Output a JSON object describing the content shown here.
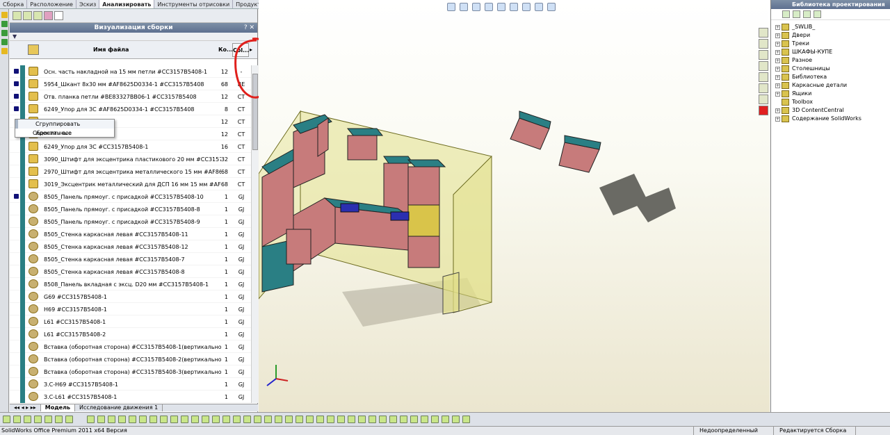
{
  "menu_tabs": [
    "Сборка",
    "Расположение",
    "Эскиз",
    "Анализировать",
    "Инструменты отрисовки",
    "Продукты Office",
    "Макрос"
  ],
  "active_tab": "Анализировать",
  "panel": {
    "title": "Визуализация сборки",
    "title_controls": "? ✕",
    "filter_icon": "filter-icon",
    "columns": {
      "name": "Имя файла",
      "qty": "Ко...",
      "col": "Col..."
    },
    "rows": [
      {
        "name": "Осн. часть накладной на 15 мм петли #CC3157B5408-1",
        "qty": "12",
        "col": "-"
      },
      {
        "name": "5954_Шкант 8х30 мм #AF8625D0334-1 #CC3157B5408",
        "qty": "68",
        "col": "BE"
      },
      {
        "name": "Отв. планка петли #BE83327BB06-1 #CC3157B5408",
        "qty": "12",
        "col": "CT"
      },
      {
        "name": "6249_Упор для ЗС #AF8625D0334-1 #CC3157B5408",
        "qty": "8",
        "col": "CT"
      },
      {
        "name": "5408-1",
        "qty": "12",
        "col": "CT"
      },
      {
        "name": "1",
        "qty": "12",
        "col": "CT"
      },
      {
        "name": "6249_Упор для ЗС #CC3157B5408-1",
        "qty": "16",
        "col": "CT"
      },
      {
        "name": "3090_Штифт для эксцентрика пластикового 20 мм #CC3157B5408-1",
        "qty": "32",
        "col": "CT"
      },
      {
        "name": "2970_Штифт для эксцентрика металлического 15 мм #AF8625D0334-1 #CC...",
        "qty": "68",
        "col": "CT"
      },
      {
        "name": "3019_Эксцентрик металлический для ДСП 16 мм 15 мм #AF8625D033...",
        "qty": "68",
        "col": "CT"
      },
      {
        "name": "8505_Панель прямоуг. с присадкой #CC3157B5408-10",
        "qty": "1",
        "col": "GJ"
      },
      {
        "name": "8505_Панель прямоуг. с присадкой #CC3157B5408-8",
        "qty": "1",
        "col": "GJ"
      },
      {
        "name": "8505_Панель прямоуг. с присадкой #CC3157B5408-9",
        "qty": "1",
        "col": "GJ"
      },
      {
        "name": "8505_Стенка каркасная левая #CC3157B5408-11",
        "qty": "1",
        "col": "GJ"
      },
      {
        "name": "8505_Стенка каркасная левая #CC3157B5408-12",
        "qty": "1",
        "col": "GJ"
      },
      {
        "name": "8505_Стенка каркасная левая #CC3157B5408-7",
        "qty": "1",
        "col": "GJ"
      },
      {
        "name": "8505_Стенка каркасная левая #CC3157B5408-8",
        "qty": "1",
        "col": "GJ"
      },
      {
        "name": "8508_Панель вкладная с эксц. D20 мм #CC3157B5408-1",
        "qty": "1",
        "col": "GJ"
      },
      {
        "name": "G69 #CC3157B5408-1",
        "qty": "1",
        "col": "GJ"
      },
      {
        "name": "H69 #CC3157B5408-1",
        "qty": "1",
        "col": "GJ"
      },
      {
        "name": "L61 #CC3157B5408-1",
        "qty": "1",
        "col": "GJ"
      },
      {
        "name": "L61 #CC3157B5408-2",
        "qty": "1",
        "col": "GJ"
      },
      {
        "name": "Вставка (оборотная сторона) #CC3157B5408-1(вертикальное напр. в...",
        "qty": "1",
        "col": "GJ"
      },
      {
        "name": "Вставка (оборотная сторона) #CC3157B5408-2(вертикальное напр. в...",
        "qty": "1",
        "col": "GJ"
      },
      {
        "name": "Вставка (оборотная сторона) #CC3157B5408-3(вертикальное напр. в...",
        "qty": "1",
        "col": "GJ"
      },
      {
        "name": "З.С-H69 #CC3157B5408-1",
        "qty": "1",
        "col": "GJ"
      },
      {
        "name": "З.С-L61 #CC3157B5408-1",
        "qty": "1",
        "col": "GJ"
      }
    ]
  },
  "context_menu": {
    "group": "Сгруппировать идентичные",
    "reset": "Сбросить все"
  },
  "bottom_tabs": [
    "Модель",
    "Исследование движения 1"
  ],
  "library": {
    "title": "Библиотека проектирования",
    "items": [
      "_SWLIB_",
      "Двери",
      "Треки",
      "ШКАФЫ-КУПЕ",
      "Разное",
      "Столешницы",
      "Библиотека",
      "Каркасные детали",
      "Ящики",
      "Toolbox",
      "3D ContentCentral",
      "Содержание SolidWorks"
    ]
  },
  "status": {
    "app": "SolidWorks Office Premium 2011 x64 Версия",
    "state": "Недоопределенный",
    "mode": "Редактируется Сборка"
  },
  "colors": {
    "accent": "#5e7090",
    "cabinet_teal": "#2a7f84",
    "cabinet_pink": "#c77b7b",
    "annotation_red": "#e0201c",
    "room_yellow": "#e2e08a"
  }
}
